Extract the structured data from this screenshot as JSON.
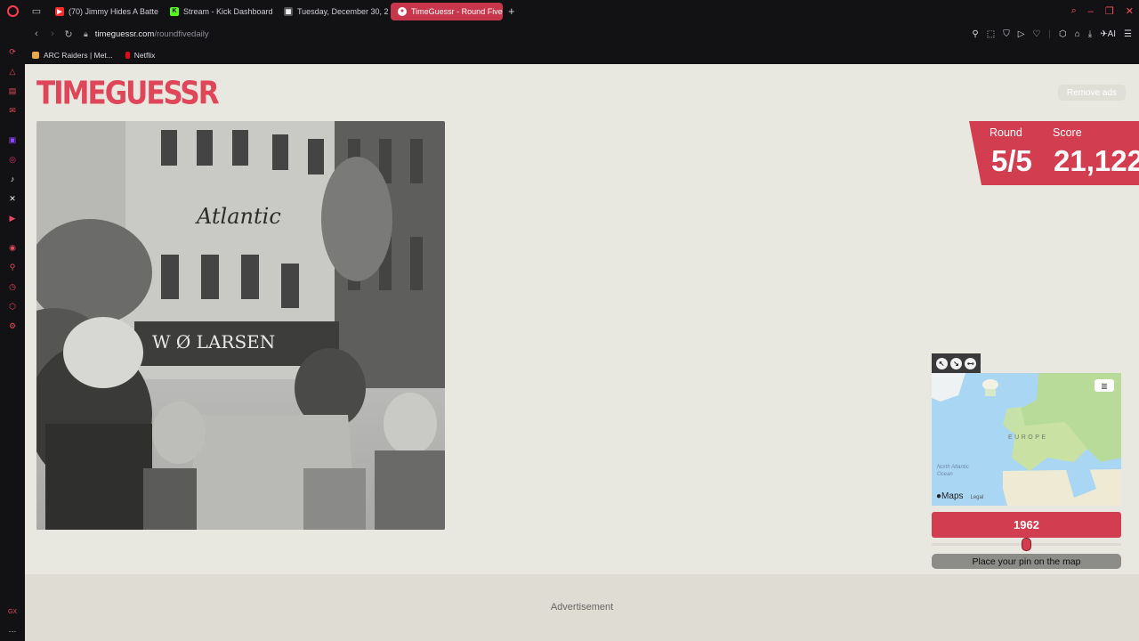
{
  "browser": {
    "tabs": [
      {
        "label": "(70) Jimmy Hides A Batte",
        "favicon_color": "#ff2a2a",
        "active": false
      },
      {
        "label": "Stream - Kick Dashboard",
        "favicon_color": "#53fc18",
        "active": false
      },
      {
        "label": "Tuesday, December 30, 2",
        "favicon_color": "#bbbbbb",
        "active": false
      },
      {
        "label": "TimeGuessr - Round Five",
        "favicon_color": "#ffffff",
        "active": true
      }
    ],
    "new_tab": "+",
    "url_domain": "timeguessr.com",
    "url_path": "/roundfivedaily",
    "ai_label": "AI",
    "bookmarks": [
      {
        "label": "ARC Raiders | Met...",
        "color": "#e7a64f"
      },
      {
        "label": "Netflix",
        "color": "#e50914"
      }
    ]
  },
  "page": {
    "logo": "TIMEGUESSR",
    "remove_ads": "Remove ads",
    "round_label": "Round",
    "round_value": "5/5",
    "score_label": "Score",
    "score_value": "21,122",
    "map": {
      "region_label": "EUROPE",
      "ocean_label": "North Atlantic Ocean",
      "attribution": "Maps",
      "legal": "Legal"
    },
    "year": "1962",
    "year_slider_fraction": 0.5,
    "place_pin": "Place your pin on the map",
    "advertisement": "Advertisement"
  },
  "colors": {
    "accent": "#d33d50",
    "page_bg": "#e9e8e0",
    "chrome_bg": "#121215"
  }
}
